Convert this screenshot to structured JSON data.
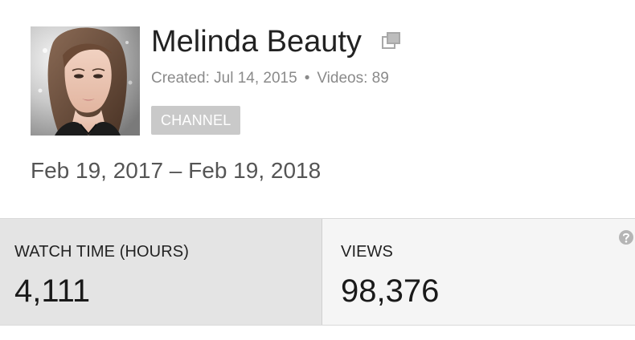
{
  "channel": {
    "name": "Melinda Beauty",
    "created": "Created: Jul 14, 2015",
    "separator": "•",
    "videos": "Videos: 89",
    "badge": "CHANNEL"
  },
  "date_range": "Feb 19, 2017 – Feb 19, 2018",
  "metrics": [
    {
      "label": "WATCH TIME (HOURS)",
      "value": "4,111",
      "selected": true
    },
    {
      "label": "VIEWS",
      "value": "98,376",
      "selected": false
    }
  ],
  "icons": {
    "external": "external-link-icon",
    "help": "help-icon"
  },
  "colors": {
    "badge_bg": "#c9c9c9",
    "selected_card_bg": "#e4e4e4",
    "card_bg": "#f5f5f5",
    "muted_text": "#8a8a8a"
  }
}
